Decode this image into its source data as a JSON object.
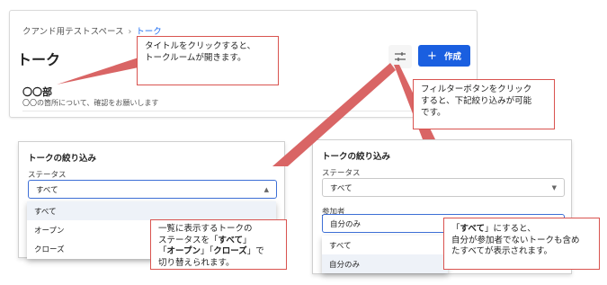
{
  "breadcrumb": {
    "workspace": "クアンド用テストスペース",
    "separator": "›",
    "current": "トーク"
  },
  "page": {
    "title": "トーク"
  },
  "toolbar": {
    "filter_icon": "filter-sliders-icon",
    "create_label": "作成",
    "create_icon": "plus-icon"
  },
  "room": {
    "title": "〇〇部",
    "description": "〇〇の箇所について、確認をお願いします"
  },
  "callouts": {
    "title_click": "タイトルをクリックすると、\nトークルームが開きます。",
    "filter_button": "フィルターボタンをクリック\nすると、下記絞り込みが可能\nです。",
    "status_part1": "一覧に表示するトークの\nステータスを「",
    "status_all": "すべて",
    "status_part2": "」\n「",
    "status_open": "オープン",
    "status_part3": "」「",
    "status_close": "クローズ",
    "status_part4": "」で\n切り替えられます。",
    "participant_part1": "「",
    "participant_all": "すべて",
    "participant_part2": "」にすると、\n自分が参加者でないトークも含め\nたすべてが表示されます。"
  },
  "filter_left": {
    "title": "トークの絞り込み",
    "status_label": "ステータス",
    "status_value": "すべて",
    "options": [
      "すべて",
      "オープン",
      "クローズ"
    ]
  },
  "filter_right": {
    "title": "トークの絞り込み",
    "status_label": "ステータス",
    "status_value": "すべて",
    "participant_label": "参加者",
    "participant_value": "自分のみ",
    "options": [
      "すべて",
      "自分のみ"
    ]
  },
  "colors": {
    "accent": "#1a5fe0",
    "callout_border": "#d9534f",
    "arrow": "#d96565"
  }
}
